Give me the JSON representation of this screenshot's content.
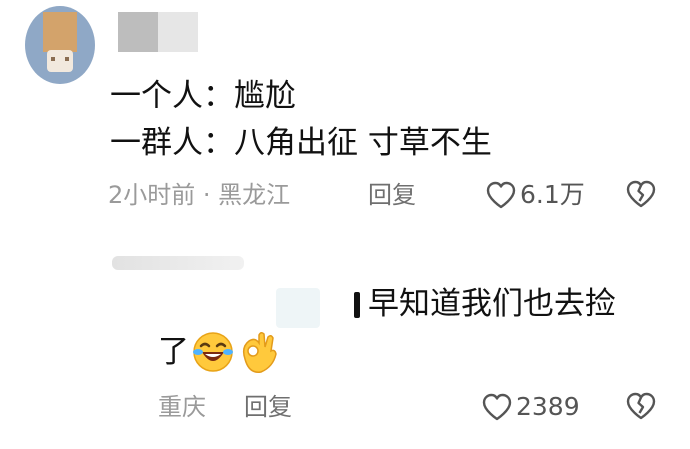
{
  "comment": {
    "lines": [
      "一个人：尴尬",
      "一群人：八角出征 寸草不生"
    ],
    "meta": {
      "time_location": "2小时前 · 黑龙江",
      "reply_label": "回复",
      "like_count": "6.1万"
    }
  },
  "reply": {
    "text_part1": "早知道我们也去捡",
    "text_part2": "了",
    "emojis": [
      "laughing-crying-emoji",
      "ok-hand-emoji"
    ],
    "meta": {
      "location": "重庆",
      "reply_label": "回复",
      "like_count": "2389"
    }
  },
  "icons": {
    "like": "heart-outline-icon",
    "dislike": "broken-heart-icon"
  },
  "colors": {
    "meta_text": "#9a9a9a",
    "main_text": "#111111",
    "emoji_yellow": "#ffc93c"
  }
}
